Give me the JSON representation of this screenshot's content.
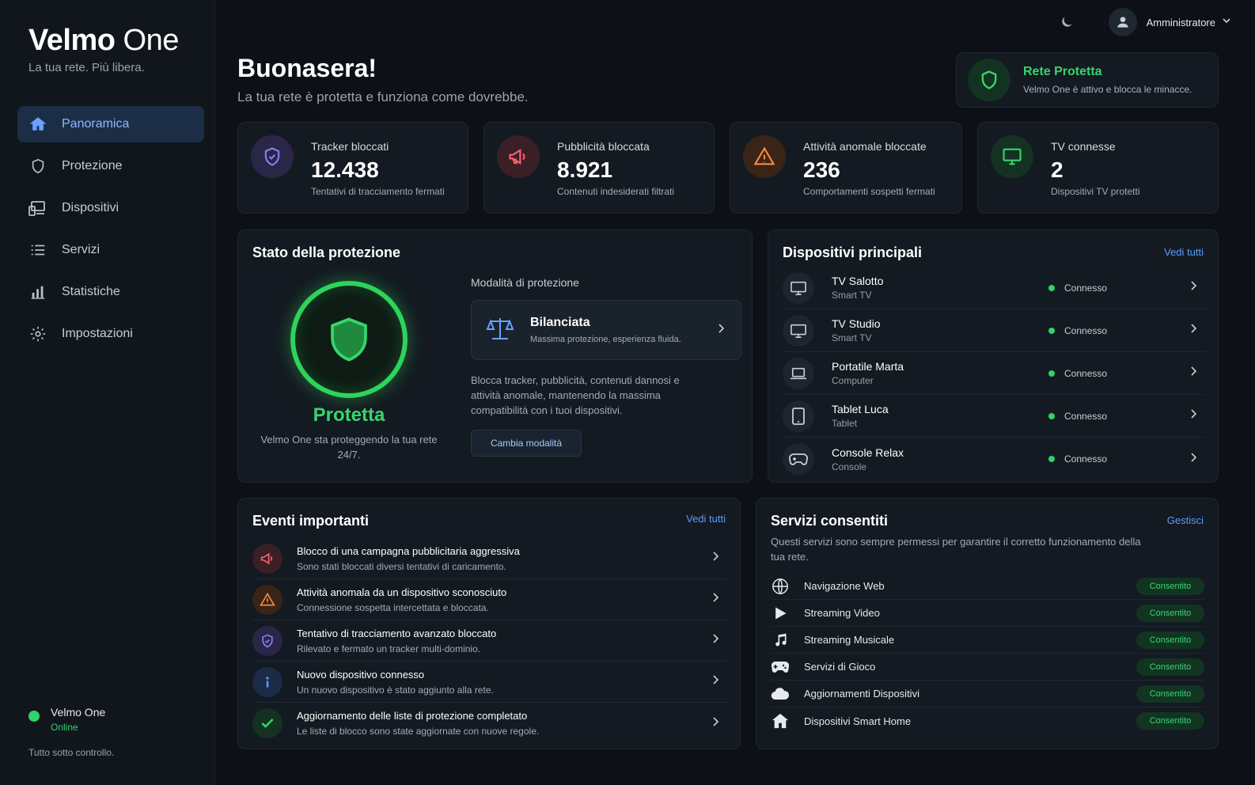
{
  "brand": {
    "name_bold": "Velmo",
    "name_light": "One",
    "tagline": "La tua rete. Più libera."
  },
  "nav": [
    {
      "label": "Panoramica",
      "icon": "home-icon",
      "active": true
    },
    {
      "label": "Protezione",
      "icon": "shield-icon"
    },
    {
      "label": "Dispositivi",
      "icon": "devices-icon"
    },
    {
      "label": "Servizi",
      "icon": "list-icon"
    },
    {
      "label": "Statistiche",
      "icon": "bar-chart-icon"
    },
    {
      "label": "Impostazioni",
      "icon": "gear-icon"
    }
  ],
  "sidebar_status": {
    "name": "Velmo One",
    "state": "Online",
    "footer": "Tutto sotto controllo."
  },
  "header": {
    "user": "Amministratore",
    "greeting": "Buonasera!",
    "subtitle": "La tua rete è protetta e funziona come dovrebbe."
  },
  "network": {
    "title": "Rete Protetta",
    "desc": "Velmo One è attivo e blocca le minacce."
  },
  "stats": [
    {
      "label": "Tracker bloccati",
      "value": "12.438",
      "sub": "Tentativi di tracciamento fermati",
      "icon": "shield-check-icon",
      "color": "#8b7cf6"
    },
    {
      "label": "Pubblicità bloccata",
      "value": "8.921",
      "sub": "Contenuti indesiderati filtrati",
      "icon": "megaphone-icon",
      "color": "#ff5f6d"
    },
    {
      "label": "Attività anomale bloccate",
      "value": "236",
      "sub": "Comportamenti sospetti fermati",
      "icon": "warning-icon",
      "color": "#ff8a3d"
    },
    {
      "label": "TV connesse",
      "value": "2",
      "sub": "Dispositivi TV protetti",
      "icon": "tv-icon",
      "color": "#36d66d"
    }
  ],
  "protection": {
    "title": "Stato della protezione",
    "status": "Protetta",
    "desc": "Velmo One sta proteggendo la tua rete 24/7.",
    "mode_label": "Modalità di protezione",
    "mode_name": "Bilanciata",
    "mode_desc": "Massima protezione, esperienza fluida.",
    "mode_text": "Blocca tracker, pubblicità, contenuti dannosi e attività anomale, mantenendo la massima compatibilità con i tuoi dispositivi.",
    "button": "Cambia modalità"
  },
  "devices": {
    "title": "Dispositivi principali",
    "link": "Vedi tutti",
    "items": [
      {
        "name": "TV Salotto",
        "type": "Smart TV",
        "status": "Connesso",
        "icon": "tv-icon"
      },
      {
        "name": "TV Studio",
        "type": "Smart TV",
        "status": "Connesso",
        "icon": "tv-icon"
      },
      {
        "name": "Portatile Marta",
        "type": "Computer",
        "status": "Connesso",
        "icon": "laptop-icon"
      },
      {
        "name": "Tablet Luca",
        "type": "Tablet",
        "status": "Connesso",
        "icon": "tablet-icon"
      },
      {
        "name": "Console Relax",
        "type": "Console",
        "status": "Connesso",
        "icon": "gamepad-icon"
      }
    ]
  },
  "events": {
    "title": "Eventi importanti",
    "link": "Vedi tutti",
    "items": [
      {
        "title": "Blocco di una campagna pubblicitaria aggressiva",
        "sub": "Sono stati bloccati diversi tentativi di caricamento.",
        "icon": "megaphone-icon",
        "color": "#ff5f6d"
      },
      {
        "title": "Attività anomala da un dispositivo sconosciuto",
        "sub": "Connessione sospetta intercettata e bloccata.",
        "icon": "warning-icon",
        "color": "#ff8a3d"
      },
      {
        "title": "Tentativo di tracciamento avanzato bloccato",
        "sub": "Rilevato e fermato un tracker multi-dominio.",
        "icon": "shield-check-icon",
        "color": "#8b7cf6"
      },
      {
        "title": "Nuovo dispositivo connesso",
        "sub": "Un nuovo dispositivo è stato aggiunto alla rete.",
        "icon": "info-icon",
        "color": "#5b9bff"
      },
      {
        "title": "Aggiornamento delle liste di protezione completato",
        "sub": "Le liste di blocco sono state aggiornate con nuove regole.",
        "icon": "check-icon",
        "color": "#36d66d"
      }
    ]
  },
  "services": {
    "title": "Servizi consentiti",
    "link": "Gestisci",
    "desc": "Questi servizi sono sempre permessi per garantire il corretto funzionamento della tua rete.",
    "items": [
      {
        "name": "Navigazione Web",
        "status": "Consentito",
        "icon": "globe-icon"
      },
      {
        "name": "Streaming Video",
        "status": "Consentito",
        "icon": "play-icon"
      },
      {
        "name": "Streaming Musicale",
        "status": "Consentito",
        "icon": "music-icon"
      },
      {
        "name": "Servizi di Gioco",
        "status": "Consentito",
        "icon": "gamepad-icon"
      },
      {
        "name": "Aggiornamenti Dispositivi",
        "status": "Consentito",
        "icon": "cloud-icon"
      },
      {
        "name": "Dispositivi Smart Home",
        "status": "Consentito",
        "icon": "home-icon"
      }
    ]
  }
}
